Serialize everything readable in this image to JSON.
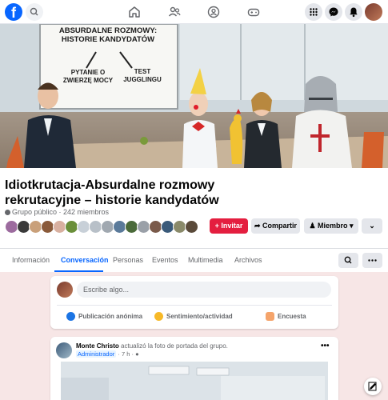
{
  "topbar": {
    "logo": "f",
    "icons": [
      "facebook-logo",
      "search-icon",
      "home-icon",
      "friends-icon",
      "groups-icon",
      "gaming-icon",
      "menu-grid-icon",
      "messenger-icon",
      "notifications-icon",
      "profile-avatar"
    ]
  },
  "cover": {
    "board_title": "ABSURDALNE ROZMOWY: HISTORIE KANDYDATÓW",
    "board_left": "PYTANIE O ZWIERZĘ MOCY",
    "board_right": "TEST JUGGLINGU"
  },
  "group": {
    "title": "Idiotkrutacja-Absurdalne rozmowy rekrutacyjne – historie kandydatów",
    "meta": "Grupo público · 242 miembros",
    "invite": "+ Invitar",
    "share": "Compartir",
    "member": "Miembro",
    "more": "⌄"
  },
  "tabs": [
    "Información",
    "Conversación",
    "Personas",
    "Eventos",
    "Multimedia",
    "Archivos"
  ],
  "active_tab": "Conversación",
  "composer": {
    "placeholder": "Escribe algo...",
    "action_anon": "Publicación anónima",
    "action_feeling": "Sentimiento/actividad",
    "action_poll": "Encuesta"
  },
  "post": {
    "author": "Monte Christo",
    "action": "actualizó la foto de portada del grupo.",
    "role": "Administrador",
    "time": "· 7 h ·",
    "more": "•••"
  },
  "colors": {
    "brand": "#0866ff",
    "invite": "#e41e3f",
    "background": "#f7e6e6"
  }
}
